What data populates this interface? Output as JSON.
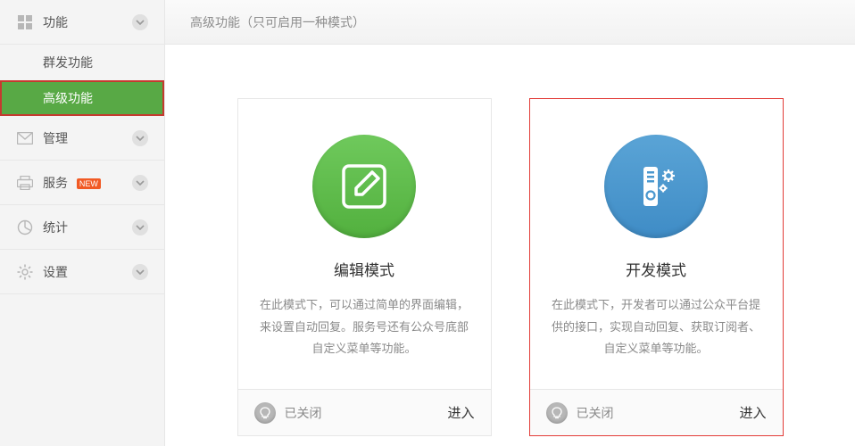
{
  "header": {
    "title": "高级功能（只可启用一种模式）"
  },
  "sidebar": {
    "groups": [
      {
        "label": "功能",
        "sub": [
          "群发功能",
          "高级功能"
        ],
        "activeIndex": 1
      },
      {
        "label": "管理"
      },
      {
        "label": "服务",
        "badge": "new"
      },
      {
        "label": "统计"
      },
      {
        "label": "设置"
      }
    ]
  },
  "cards": {
    "edit": {
      "title": "编辑模式",
      "desc": "在此模式下，可以通过简单的界面编辑，来设置自动回复。服务号还有公众号底部自定义菜单等功能。",
      "status": "已关闭",
      "enter": "进入"
    },
    "dev": {
      "title": "开发模式",
      "desc": "在此模式下，开发者可以通过公众平台提供的接口，实现自动回复、获取订阅者、自定义菜单等功能。",
      "status": "已关闭",
      "enter": "进入"
    }
  }
}
